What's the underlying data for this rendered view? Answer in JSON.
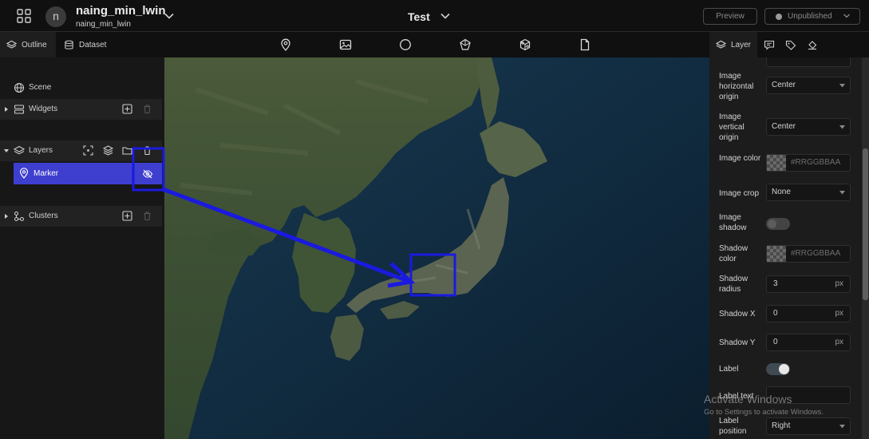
{
  "header": {
    "avatar_letter": "n",
    "user_name": "naing_min_lwin",
    "user_sub": "naing_min_lwin",
    "project_title": "Test",
    "preview_label": "Preview",
    "publish_label": "Unpublished"
  },
  "left_tabs": {
    "outline": "Outline",
    "dataset": "Dataset"
  },
  "outline": {
    "scene": "Scene",
    "widgets": "Widgets",
    "layers": "Layers",
    "marker": "Marker",
    "clusters": "Clusters"
  },
  "right_tabs": {
    "layer": "Layer"
  },
  "properties": {
    "image_horizontal_origin": {
      "label": "Image horizontal origin",
      "value": "Center"
    },
    "image_vertical_origin": {
      "label": "Image vertical origin",
      "value": "Center"
    },
    "image_color": {
      "label": "Image color",
      "placeholder": "#RRGGBBAA"
    },
    "image_crop": {
      "label": "Image crop",
      "value": "None"
    },
    "image_shadow": {
      "label": "Image shadow",
      "on": false
    },
    "shadow_color": {
      "label": "Shadow color",
      "placeholder": "#RRGGBBAA"
    },
    "shadow_radius": {
      "label": "Shadow radius",
      "value": "3",
      "unit": "px"
    },
    "shadow_x": {
      "label": "Shadow X",
      "value": "0",
      "unit": "px"
    },
    "shadow_y": {
      "label": "Shadow Y",
      "value": "0",
      "unit": "px"
    },
    "label": {
      "label": "Label",
      "on": true
    },
    "label_text": {
      "label": "Label text",
      "value": ""
    },
    "label_position": {
      "label": "Label position",
      "value": "Right"
    }
  },
  "watermark": {
    "title": "Activate Windows",
    "sub": "Go to Settings to activate Windows."
  },
  "colors": {
    "accent": "#3e3ecf",
    "annotation": "#1a1adf",
    "background": "#1b1b1b"
  }
}
